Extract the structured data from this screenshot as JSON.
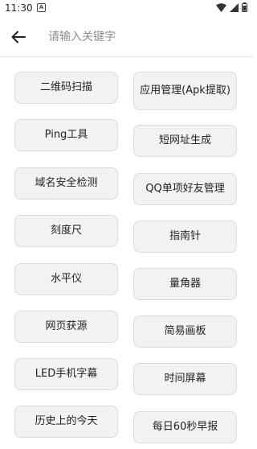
{
  "status_bar": {
    "time": "11:30",
    "notification_glyph": "A"
  },
  "search": {
    "placeholder": "请输入关键字"
  },
  "tools_left": [
    "二维码扫描",
    "Ping工具",
    "域名安全检测",
    "刻度尺",
    "水平仪",
    "网页获源",
    "LED手机字幕",
    "历史上的今天"
  ],
  "tools_right": [
    "应用管理(Apk提取)",
    "短网址生成",
    "QQ单项好友管理",
    "指南针",
    "量角器",
    "简易画板",
    "时间屏幕",
    "每日60秒早报"
  ],
  "colors": {
    "button_bg": "#f2f2f2",
    "button_border": "#dcdcdc",
    "placeholder": "#8f8f8f"
  },
  "icons": [
    "notification-icon",
    "wifi-icon",
    "signal-icon",
    "battery-icon",
    "back-arrow-icon"
  ]
}
